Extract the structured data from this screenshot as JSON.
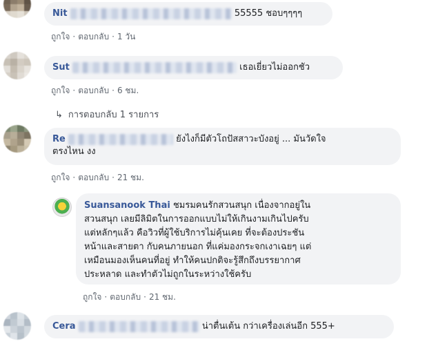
{
  "comments": [
    {
      "name": "Nit",
      "text": "55555 ชอบๆๆๆๆ",
      "actions": {
        "like": "ถูกใจ",
        "reply": "ตอบกลับ",
        "time": "1 วัน"
      }
    },
    {
      "name": "Sut",
      "text": "เธอเยี่ยวไม่ออกชัว",
      "actions": {
        "like": "ถูกใจ",
        "reply": "ตอบกลับ",
        "time": "6 ชม."
      },
      "replies_link": "การตอบกลับ 1 รายการ"
    },
    {
      "name": "Re",
      "text_line1": "ยังไงก็มีตัวโถปัสสาวะบังอยู่ ... มันวัดใจ",
      "text_line2": "ตรงไหน งง",
      "actions": {
        "like": "ถูกใจ",
        "reply": "ตอบกลับ",
        "time": "21 ชม."
      }
    },
    {
      "name": "Suansanook Thai",
      "lines": [
        "ชมรมคนรักสวนสนุก เนื่องจากอยู่ใน",
        "สวนสนุก เลยมีลิมิตในการออกแบบไม่ให้เกินงามเกินไปครับ",
        "แต่หลักๆแล้ว คือวิวที่ผู้ใช้บริการไม่คุ้นเคย ที่จะต้องประชัน",
        "หน้าและสายตา กับคนภายนอก ที่แค่มองกระจกเงาเฉยๆ แต่",
        "เหมือนมองเห็นคนที่อยู่ ทำให้คนปกติจะรู้สึกถึงบรรยากาศ",
        "ประหลาด และทำตัวไม่ถูกในระหว่างใช้ครับ"
      ],
      "actions": {
        "like": "ถูกใจ",
        "reply": "ตอบกลับ",
        "time": "21 ชม."
      }
    },
    {
      "name": "Cera",
      "text": "น่าตื่นเต้น กว่าเครื่องเล่นอีก 555+"
    }
  ],
  "colors": {
    "name": "#385898",
    "bubble": "#f2f3f5",
    "meta": "#606770"
  }
}
